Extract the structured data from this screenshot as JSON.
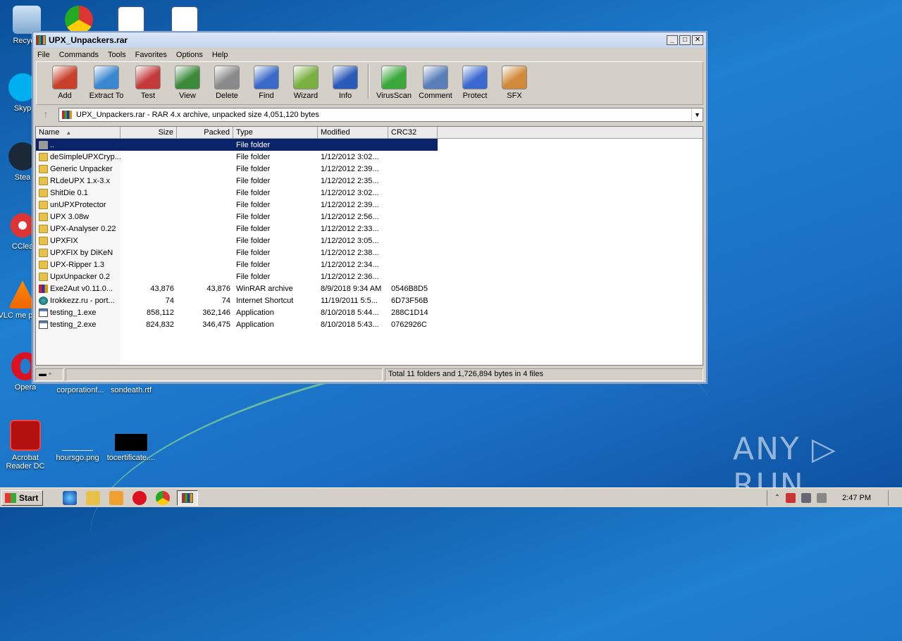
{
  "desktop": {
    "icons": [
      {
        "label": "Recycle"
      },
      {
        "label": "Skyp"
      },
      {
        "label": "Stea"
      },
      {
        "label": "CClea"
      },
      {
        "label": "VLC me playe"
      },
      {
        "label": "Opera"
      },
      {
        "label": "corporationf..."
      },
      {
        "label": "sondeath.rtf"
      },
      {
        "label": "Acrobat Reader DC"
      },
      {
        "label": "hoursgo.png"
      },
      {
        "label": "tocertificate...."
      }
    ],
    "watermark": "ANY ▷ RUN"
  },
  "window": {
    "title": "UPX_Unpackers.rar",
    "controls": {
      "minimize": "_",
      "maximize": "□",
      "close": "✕"
    },
    "menu": [
      "File",
      "Commands",
      "Tools",
      "Favorites",
      "Options",
      "Help"
    ],
    "toolbar": [
      {
        "label": "Add",
        "icon": "add-archive-icon",
        "color": "#c8402a"
      },
      {
        "label": "Extract To",
        "icon": "extract-folder-icon",
        "color": "#3a86d0"
      },
      {
        "label": "Test",
        "icon": "test-clipboard-icon",
        "color": "#c43a3a"
      },
      {
        "label": "View",
        "icon": "view-book-icon",
        "color": "#3a8a3a"
      },
      {
        "label": "Delete",
        "icon": "trash-icon",
        "color": "#8a8a8a"
      },
      {
        "label": "Find",
        "icon": "magnifier-icon",
        "color": "#3a6ac8"
      },
      {
        "label": "Wizard",
        "icon": "wand-icon",
        "color": "#7ab040"
      },
      {
        "label": "Info",
        "icon": "info-icon",
        "color": "#2a5ab8"
      },
      {
        "label": "VirusScan",
        "icon": "bug-icon",
        "color": "#3aa83a"
      },
      {
        "label": "Comment",
        "icon": "comment-icon",
        "color": "#5a7fb8"
      },
      {
        "label": "Protect",
        "icon": "shield-icon",
        "color": "#3a6ad0"
      },
      {
        "label": "SFX",
        "icon": "sfx-icon",
        "color": "#d08a3a"
      }
    ],
    "address": "UPX_Unpackers.rar - RAR 4.x archive, unpacked size 4,051,120 bytes",
    "columns": [
      "Name",
      "Size",
      "Packed",
      "Type",
      "Modified",
      "CRC32"
    ],
    "rows": [
      {
        "name": "..",
        "size": "",
        "packed": "",
        "type": "File folder",
        "modified": "",
        "crc": "",
        "kind": "up"
      },
      {
        "name": "deSimpleUPXCryp...",
        "size": "",
        "packed": "",
        "type": "File folder",
        "modified": "1/12/2012 3:02...",
        "crc": "",
        "kind": "folder"
      },
      {
        "name": "Generic Unpacker",
        "size": "",
        "packed": "",
        "type": "File folder",
        "modified": "1/12/2012 2:39...",
        "crc": "",
        "kind": "folder"
      },
      {
        "name": "RLdeUPX 1.x-3.x",
        "size": "",
        "packed": "",
        "type": "File folder",
        "modified": "1/12/2012 2:35...",
        "crc": "",
        "kind": "folder"
      },
      {
        "name": "ShitDie 0.1",
        "size": "",
        "packed": "",
        "type": "File folder",
        "modified": "1/12/2012 3:02...",
        "crc": "",
        "kind": "folder"
      },
      {
        "name": "unUPXProtector",
        "size": "",
        "packed": "",
        "type": "File folder",
        "modified": "1/12/2012 2:39...",
        "crc": "",
        "kind": "folder"
      },
      {
        "name": "UPX 3.08w",
        "size": "",
        "packed": "",
        "type": "File folder",
        "modified": "1/12/2012 2:56...",
        "crc": "",
        "kind": "folder"
      },
      {
        "name": "UPX-Analyser 0.22",
        "size": "",
        "packed": "",
        "type": "File folder",
        "modified": "1/12/2012 2:33...",
        "crc": "",
        "kind": "folder"
      },
      {
        "name": "UPXFIX",
        "size": "",
        "packed": "",
        "type": "File folder",
        "modified": "1/12/2012 3:05...",
        "crc": "",
        "kind": "folder"
      },
      {
        "name": "UPXFIX by DiKeN",
        "size": "",
        "packed": "",
        "type": "File folder",
        "modified": "1/12/2012 2:38...",
        "crc": "",
        "kind": "folder"
      },
      {
        "name": "UPX-Ripper 1.3",
        "size": "",
        "packed": "",
        "type": "File folder",
        "modified": "1/12/2012 2:34...",
        "crc": "",
        "kind": "folder"
      },
      {
        "name": "UpxUnpacker 0.2",
        "size": "",
        "packed": "",
        "type": "File folder",
        "modified": "1/12/2012 2:36...",
        "crc": "",
        "kind": "folder"
      },
      {
        "name": "Exe2Aut v0.11.0...",
        "size": "43,876",
        "packed": "43,876",
        "type": "WinRAR archive",
        "modified": "8/9/2018 9:34 AM",
        "crc": "0546B8D5",
        "kind": "rar"
      },
      {
        "name": "Irokkezz.ru - port...",
        "size": "74",
        "packed": "74",
        "type": "Internet Shortcut",
        "modified": "11/19/2011 5:5...",
        "crc": "6D73F56B",
        "kind": "globe"
      },
      {
        "name": "testing_1.exe",
        "size": "858,112",
        "packed": "362,146",
        "type": "Application",
        "modified": "8/10/2018 5:44...",
        "crc": "288C1D14",
        "kind": "exe"
      },
      {
        "name": "testing_2.exe",
        "size": "824,832",
        "packed": "346,475",
        "type": "Application",
        "modified": "8/10/2018 5:43...",
        "crc": "0762926C",
        "kind": "exe"
      }
    ],
    "status": "Total 11 folders and 1,726,894 bytes in 4 files"
  },
  "taskbar": {
    "start_label": "Start",
    "clock": "2:47 PM"
  }
}
